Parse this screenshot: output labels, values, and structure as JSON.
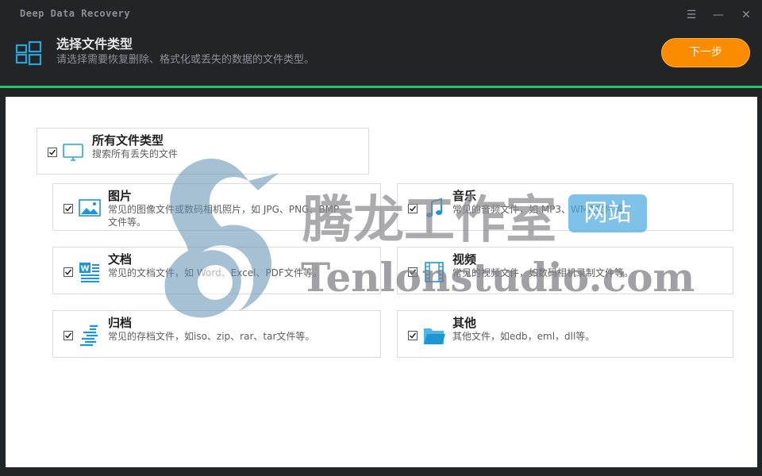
{
  "app": {
    "title": "Deep Data Recovery"
  },
  "window_controls": {
    "menu": "☰",
    "minimize": "—",
    "close": "✕"
  },
  "header": {
    "title": "选择文件类型",
    "subtitle": "请选择需要恢复删除、格式化或丢失的数据的文件类型。",
    "icon": "windows-grid-icon",
    "next_label": "下一步"
  },
  "colors": {
    "accent_orange": "#fb8c00",
    "accent_green": "#1fc46a",
    "icon_blue": "#1e96d2"
  },
  "all_types": {
    "title": "所有文件类型",
    "desc": "搜索所有丢失的文件",
    "checked": true,
    "icon": "monitor-icon"
  },
  "categories": [
    {
      "title": "图片",
      "desc": "常见的图像文件或数码相机照片，如 JPG、PNG、BMP文件等。",
      "checked": true,
      "icon": "image-icon"
    },
    {
      "title": "音乐",
      "desc": "常见的音频文件，如 MP3、WMA文件等。",
      "checked": true,
      "icon": "music-note-icon"
    },
    {
      "title": "文档",
      "desc": "常见的文档文件，如 Word、Excel、PDF文件等。",
      "checked": true,
      "icon": "word-document-icon"
    },
    {
      "title": "视频",
      "desc": "常见的视频文件，如数码相机录制文件等。",
      "checked": true,
      "icon": "film-icon"
    },
    {
      "title": "归档",
      "desc": "常见的存档文件，如iso、zip、rar、tar文件等。",
      "checked": true,
      "icon": "archive-icon"
    },
    {
      "title": "其他",
      "desc": "其他文件，如edb，eml，dll等。",
      "checked": true,
      "icon": "folder-icon"
    }
  ],
  "watermark": {
    "cn": "腾龙工作室",
    "badge": "网站",
    "en": "Tenlonstudio.com",
    "icon": "dragon-logo-icon"
  }
}
